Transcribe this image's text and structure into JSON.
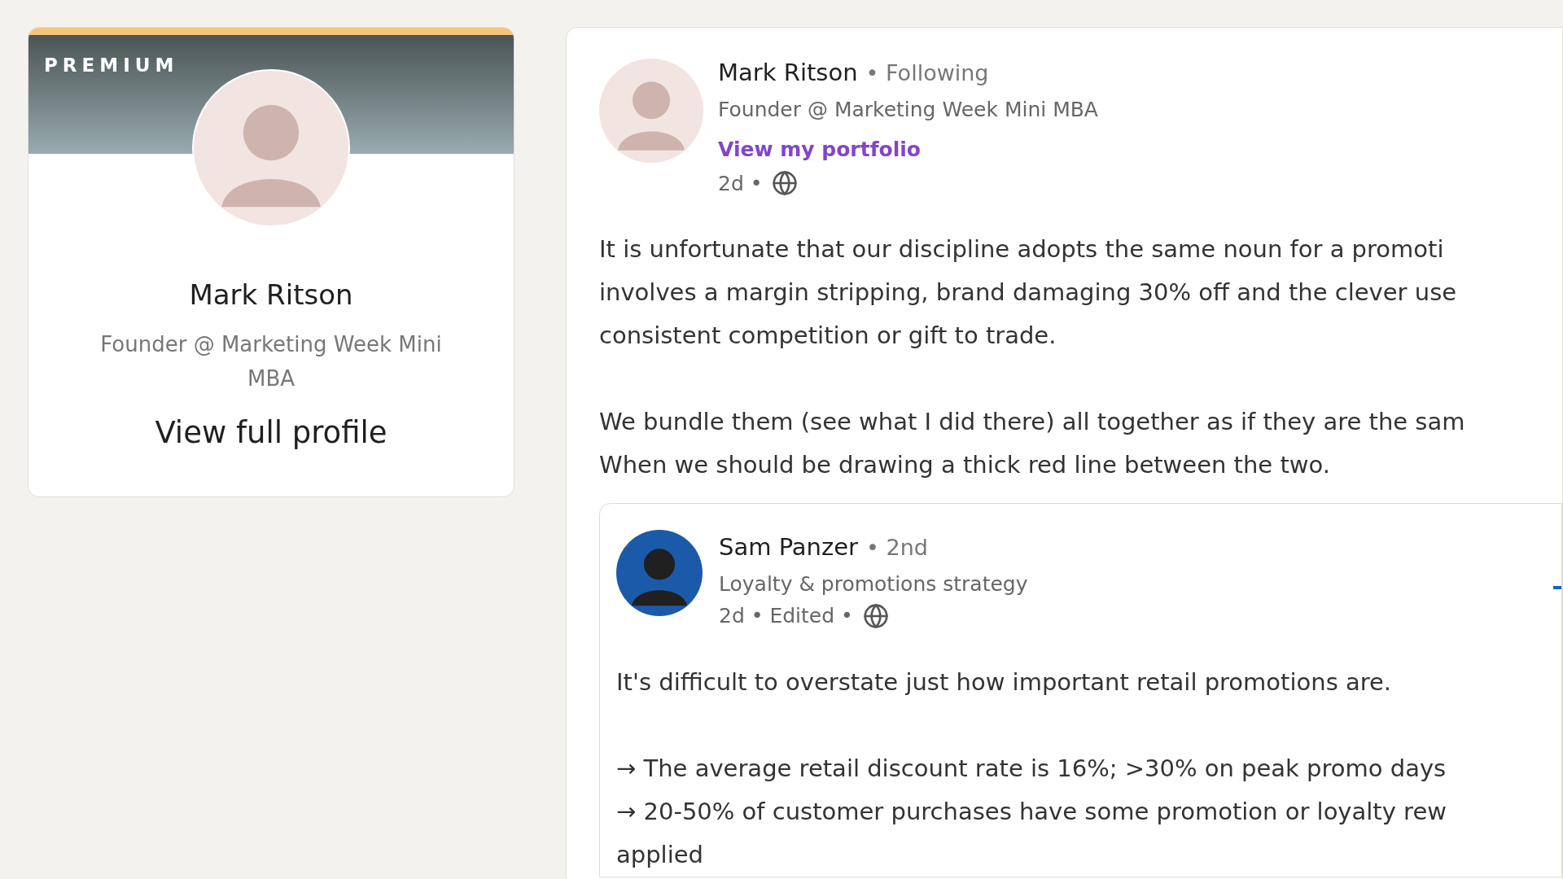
{
  "profile_card": {
    "badge": "PREMIUM",
    "name": "Mark Ritson",
    "headline": "Founder @ Marketing Week Mini MBA",
    "link": "View full profile"
  },
  "post": {
    "author": {
      "name": "Mark Ritson",
      "relation": "• Following",
      "headline": "Founder @ Marketing Week Mini MBA",
      "link": "View my portfolio",
      "time": "2d •"
    },
    "paragraphs": [
      [
        "It is unfortunate that our discipline adopts the same noun for a promoti",
        "involves a margin stripping, brand damaging 30% off and the clever use",
        "consistent competition or gift to trade."
      ],
      [
        "We bundle them (see what I did there) all together as if they are the sam",
        "When we should be drawing a thick red line between the two."
      ]
    ],
    "repost": {
      "author": {
        "name": "Sam Panzer",
        "relation": "• 2nd",
        "headline": "Loyalty & promotions strategy",
        "time": "2d • Edited •"
      },
      "paragraphs": [
        [
          "It's difficult to overstate just how important retail promotions are."
        ],
        [
          "→ The average retail discount rate is 16%; >30% on peak promo days",
          "→ 20-50% of customer purchases have some promotion or loyalty rew",
          "applied"
        ]
      ]
    }
  }
}
